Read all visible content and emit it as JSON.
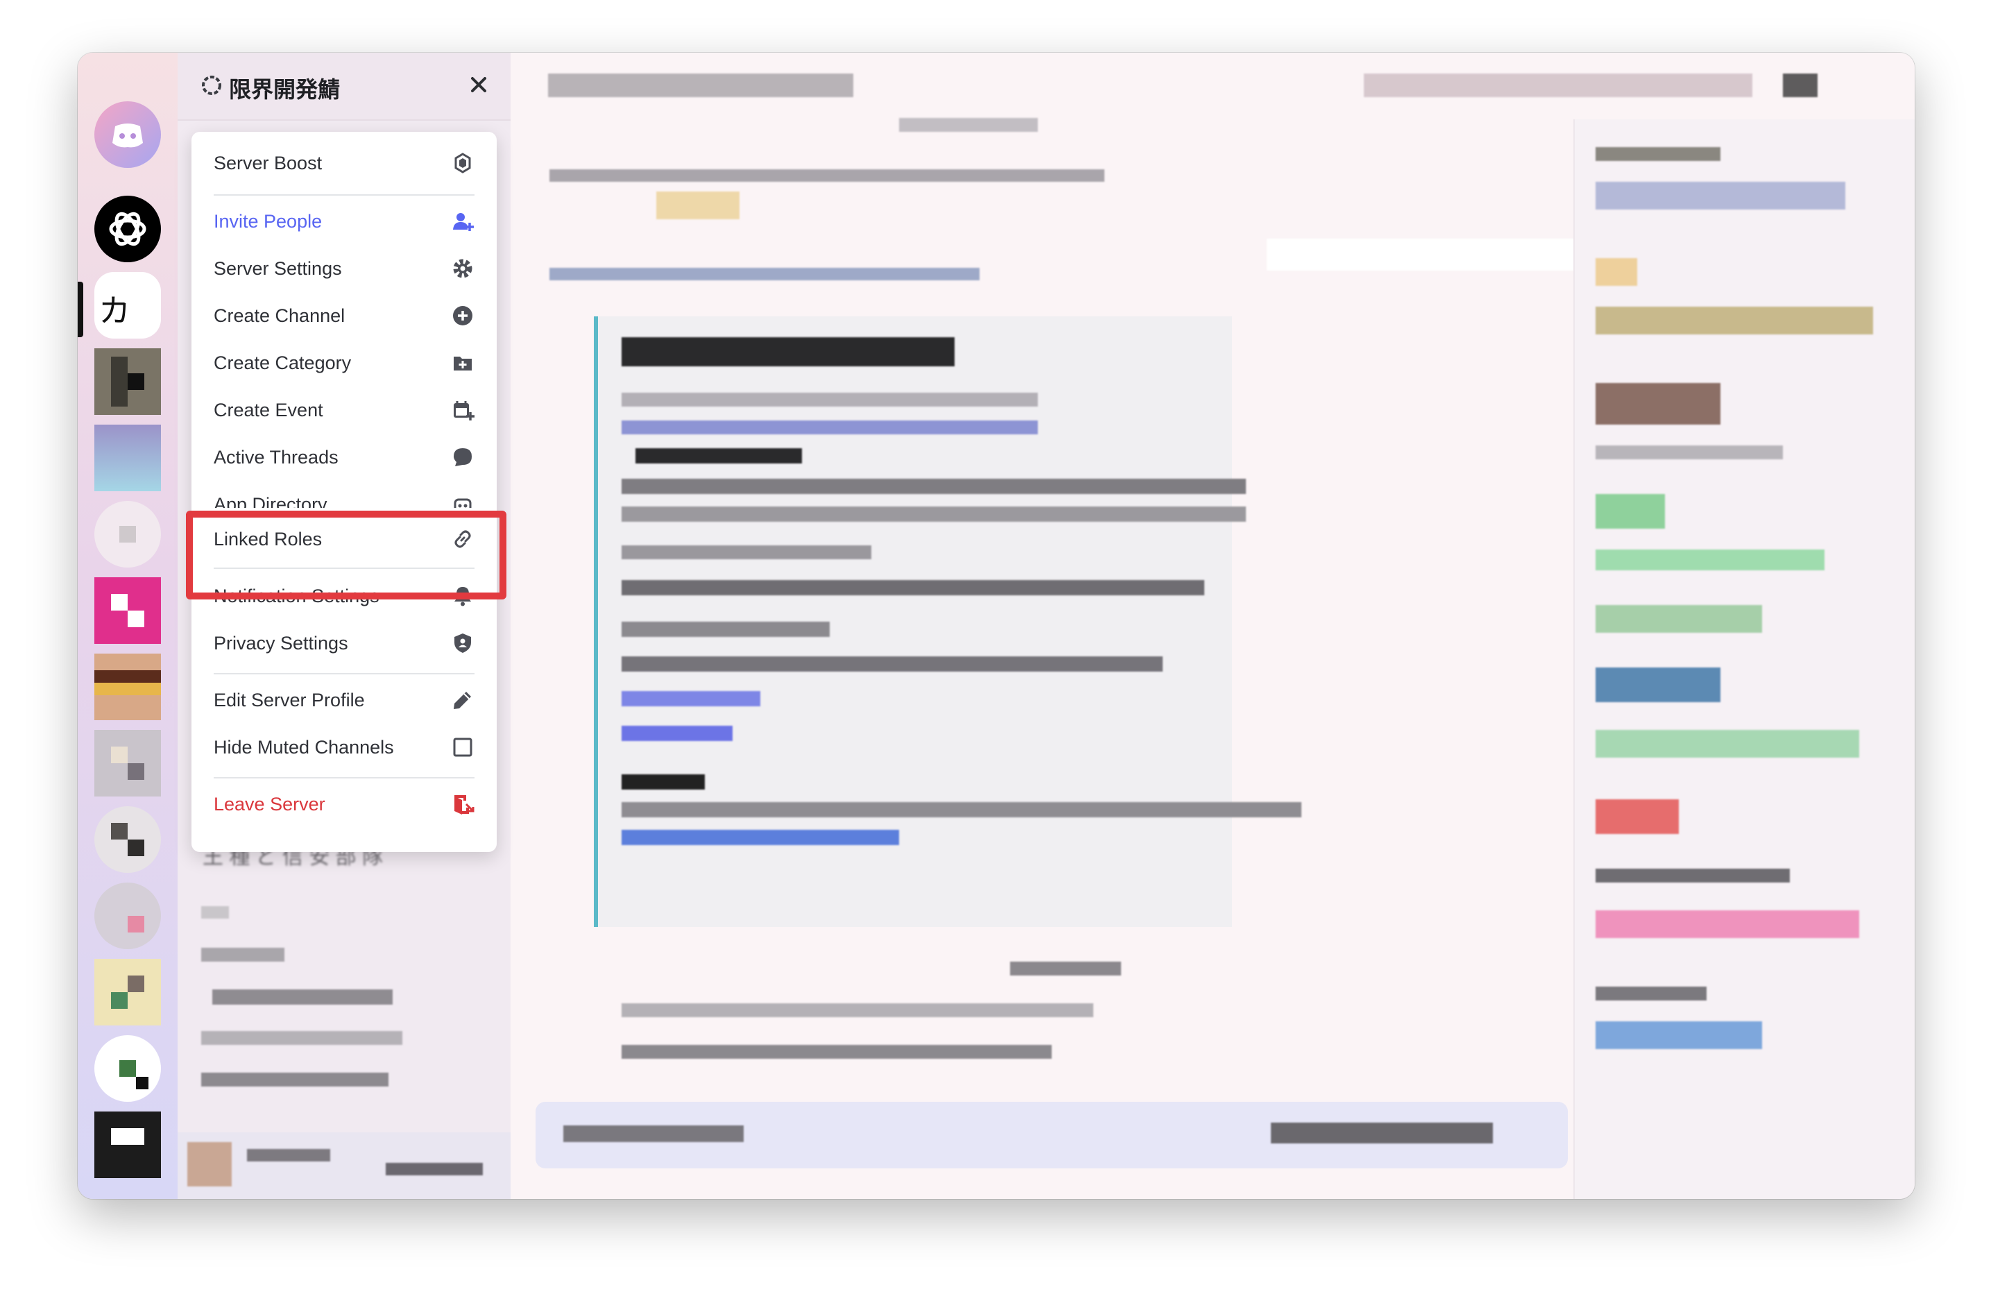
{
  "window": {
    "traffic_lights": [
      "#ff5f57",
      "#febc2e",
      "#28c840"
    ]
  },
  "server": {
    "name": "限界開発鯖",
    "rail_logo_text": "カス"
  },
  "menu": {
    "items": [
      {
        "label": "Server Boost",
        "icon": "boost-icon",
        "color": "#2e3036"
      },
      {
        "label": "Invite People",
        "icon": "add-person-icon",
        "color": "#5865f2"
      },
      {
        "label": "Server Settings",
        "icon": "gear-icon",
        "color": "#2e3036"
      },
      {
        "label": "Create Channel",
        "icon": "plus-circle-icon",
        "color": "#2e3036"
      },
      {
        "label": "Create Category",
        "icon": "folder-plus-icon",
        "color": "#2e3036"
      },
      {
        "label": "Create Event",
        "icon": "calendar-plus-icon",
        "color": "#2e3036"
      },
      {
        "label": "Active Threads",
        "icon": "threads-icon",
        "color": "#2e3036"
      },
      {
        "label": "App Directory",
        "icon": "robot-icon",
        "color": "#2e3036"
      },
      {
        "label": "Linked Roles",
        "icon": "link-icon",
        "color": "#2e3036"
      },
      {
        "label": "Notification Settings",
        "icon": "bell-icon",
        "color": "#2e3036"
      },
      {
        "label": "Privacy Settings",
        "icon": "shield-icon",
        "color": "#2e3036"
      },
      {
        "label": "Edit Server Profile",
        "icon": "pencil-icon",
        "color": "#2e3036"
      },
      {
        "label": "Hide Muted Channels",
        "icon": "checkbox-icon",
        "color": "#2e3036"
      },
      {
        "label": "Leave Server",
        "icon": "leave-icon",
        "color": "#da373c"
      }
    ],
    "highlighted_item": "Linked Roles",
    "highlight_color": "#e23a3f"
  },
  "channel_partial": "王 種 ど 信 安 部 隊"
}
